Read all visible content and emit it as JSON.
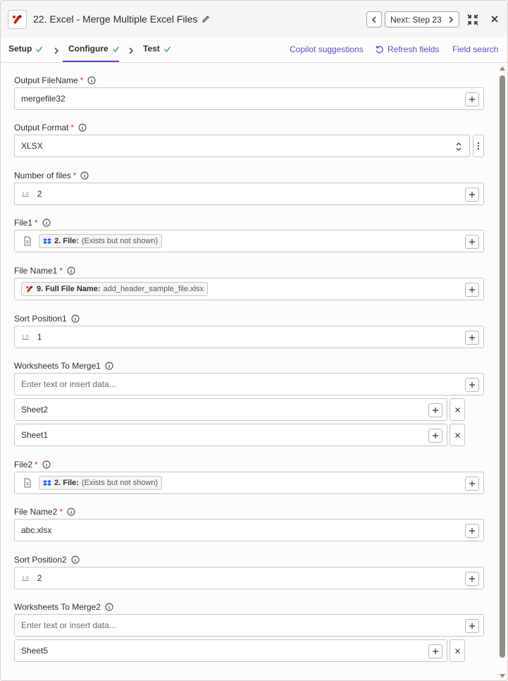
{
  "header": {
    "title": "22. Excel - Merge Multiple Excel Files",
    "next_label": "Next: Step 23"
  },
  "tabs": [
    {
      "label": "Setup"
    },
    {
      "label": "Configure"
    },
    {
      "label": "Test"
    }
  ],
  "links": {
    "copilot": "Copilot suggestions",
    "refresh": "Refresh fields",
    "search": "Field search"
  },
  "fields": {
    "output_filename": {
      "label": "Output FileName",
      "value": "mergefile32"
    },
    "output_format": {
      "label": "Output Format",
      "value": "XLSX"
    },
    "number_of_files": {
      "label": "Number of files",
      "value": "2"
    },
    "file1": {
      "label": "File1",
      "pill_label": "2. File:",
      "pill_value": "(Exists but not shown)"
    },
    "file_name1": {
      "label": "File Name1",
      "pill_label": "9. Full File Name:",
      "pill_value": "add_header_sample_file.xlsx"
    },
    "sort_position1": {
      "label": "Sort Position1",
      "value": "1"
    },
    "worksheets1": {
      "label": "Worksheets To Merge1",
      "placeholder": "Enter text or insert data...",
      "items": [
        "Sheet2",
        "Sheet1"
      ]
    },
    "file2": {
      "label": "File2",
      "pill_label": "2. File:",
      "pill_value": "(Exists but not shown)"
    },
    "file_name2": {
      "label": "File Name2",
      "value": "abc.xlsx"
    },
    "sort_position2": {
      "label": "Sort Position2",
      "value": "2"
    },
    "worksheets2": {
      "label": "Worksheets To Merge2",
      "placeholder": "Enter text or insert data...",
      "items": [
        "Sheet5"
      ]
    }
  },
  "number_tag": "1.0",
  "required_marker": "*",
  "colors": {
    "accent": "#5c3fd6",
    "required": "#d83e2a",
    "success": "#2f9e55",
    "dropbox": "#0061fe"
  }
}
